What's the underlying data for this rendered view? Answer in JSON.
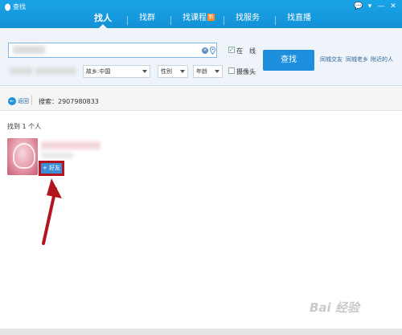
{
  "window": {
    "title": "查找"
  },
  "controls": {
    "feedback": "💬",
    "menu": "▾",
    "minimize": "—",
    "close": "✕"
  },
  "tabs": [
    {
      "label": "找人",
      "active": true
    },
    {
      "label": "找群"
    },
    {
      "label": "找课程",
      "badge": "新"
    },
    {
      "label": "找服务"
    },
    {
      "label": "找直播"
    }
  ],
  "search": {
    "clear": "✕",
    "online_check": "✓",
    "online_label": "在　线",
    "camera_label": "摄像头",
    "button": "查找",
    "hometown": "故乡:中国",
    "gender": "性别",
    "age": "年龄"
  },
  "quick_links": [
    "同城交友",
    "同城老乡",
    "附近的人"
  ],
  "nav": {
    "back_icon": "←",
    "back": "返回",
    "summary": "搜索：2907980833"
  },
  "results": {
    "count_text": "找到 1 个人",
    "add_friend": "+ 好友"
  },
  "watermark": "Bai 经验",
  "colors": {
    "accent": "#1e8fdc",
    "highlight": "#b3141e"
  }
}
